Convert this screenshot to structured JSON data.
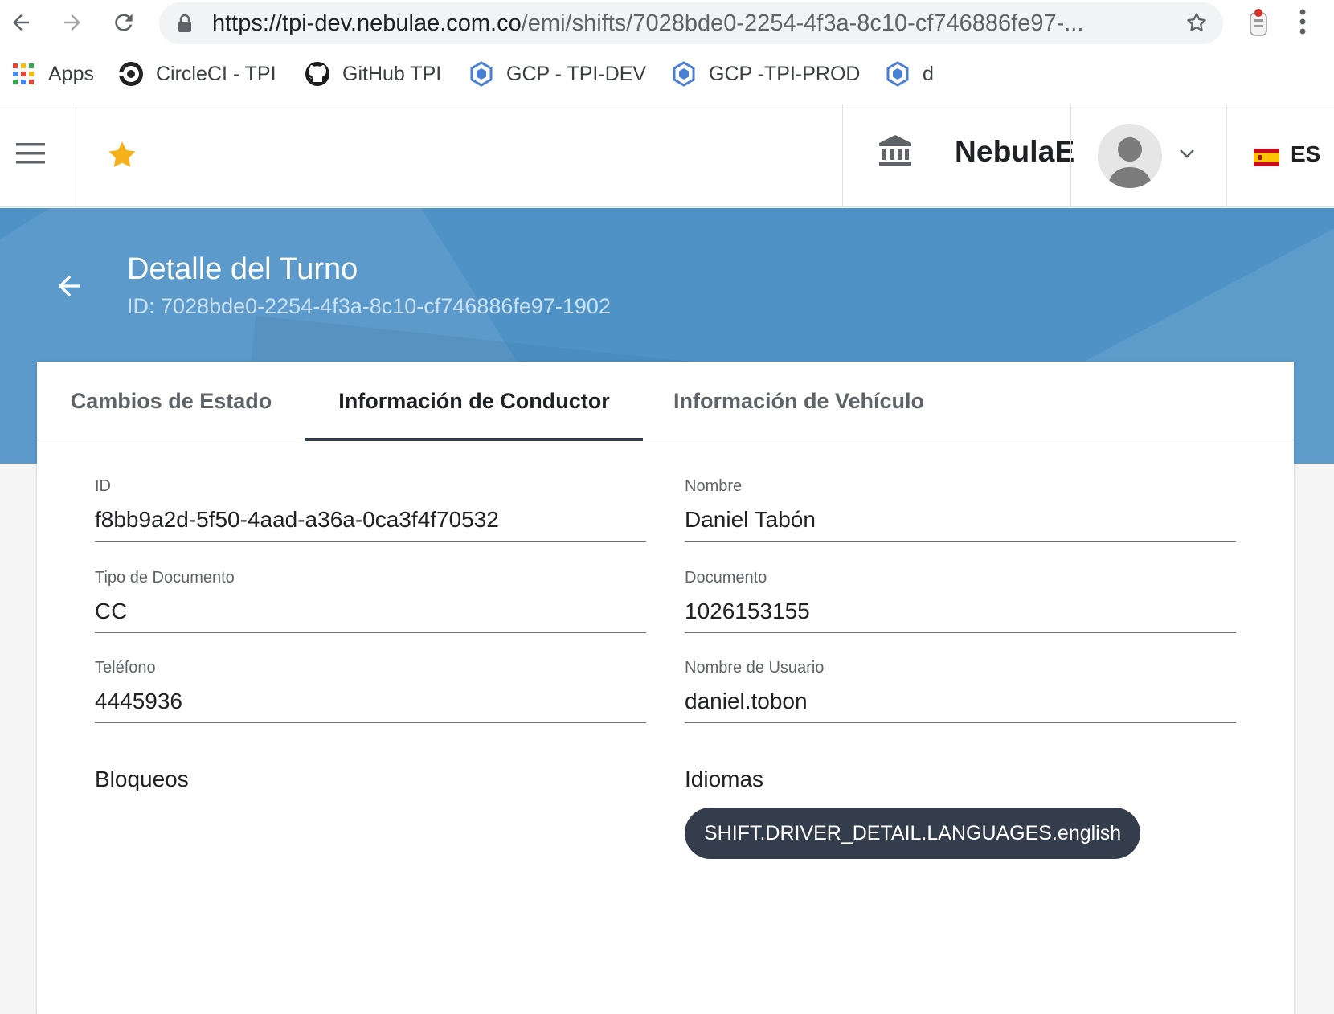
{
  "browser": {
    "url_host": "https://tpi-dev.nebulae.com.co",
    "url_path": "/emi/shifts/7028bde0-2254-4f3a-8c10-cf746886fe97-...",
    "bookmarks": [
      {
        "label": "Apps",
        "icon": "apps-grid-icon"
      },
      {
        "label": "CircleCI - TPI",
        "icon": "circleci-icon"
      },
      {
        "label": "GitHub TPI",
        "icon": "github-icon"
      },
      {
        "label": "GCP - TPI-DEV",
        "icon": "gcp-icon"
      },
      {
        "label": "GCP -TPI-PROD",
        "icon": "gcp-icon"
      },
      {
        "label": "d",
        "icon": "gcp-icon"
      }
    ]
  },
  "header": {
    "org_name": "NebulaE",
    "language": "ES"
  },
  "page": {
    "title": "Detalle del Turno",
    "subtitle": "ID: 7028bde0-2254-4f3a-8c10-cf746886fe97-1902"
  },
  "tabs": [
    {
      "label": "Cambios de Estado",
      "active": false
    },
    {
      "label": "Información de Conductor",
      "active": true
    },
    {
      "label": "Información de Vehículo",
      "active": false
    }
  ],
  "driver": {
    "id_label": "ID",
    "id_value": "f8bb9a2d-5f50-4aad-a36a-0ca3f4f70532",
    "name_label": "Nombre",
    "name_value": "Daniel Tabón",
    "doc_type_label": "Tipo de Documento",
    "doc_type_value": "CC",
    "doc_label": "Documento",
    "doc_value": "1026153155",
    "phone_label": "Teléfono",
    "phone_value": "4445936",
    "username_label": "Nombre de Usuario",
    "username_value": "daniel.tobon",
    "blocks_title": "Bloqueos",
    "languages_title": "Idiomas",
    "languages": [
      "SHIFT.DRIVER_DETAIL.LANGUAGES.english"
    ]
  },
  "colors": {
    "banner": "#4f93c6",
    "chip": "#333d4b",
    "active_tab_indicator": "#333d4b",
    "star": "#f5b01a"
  }
}
